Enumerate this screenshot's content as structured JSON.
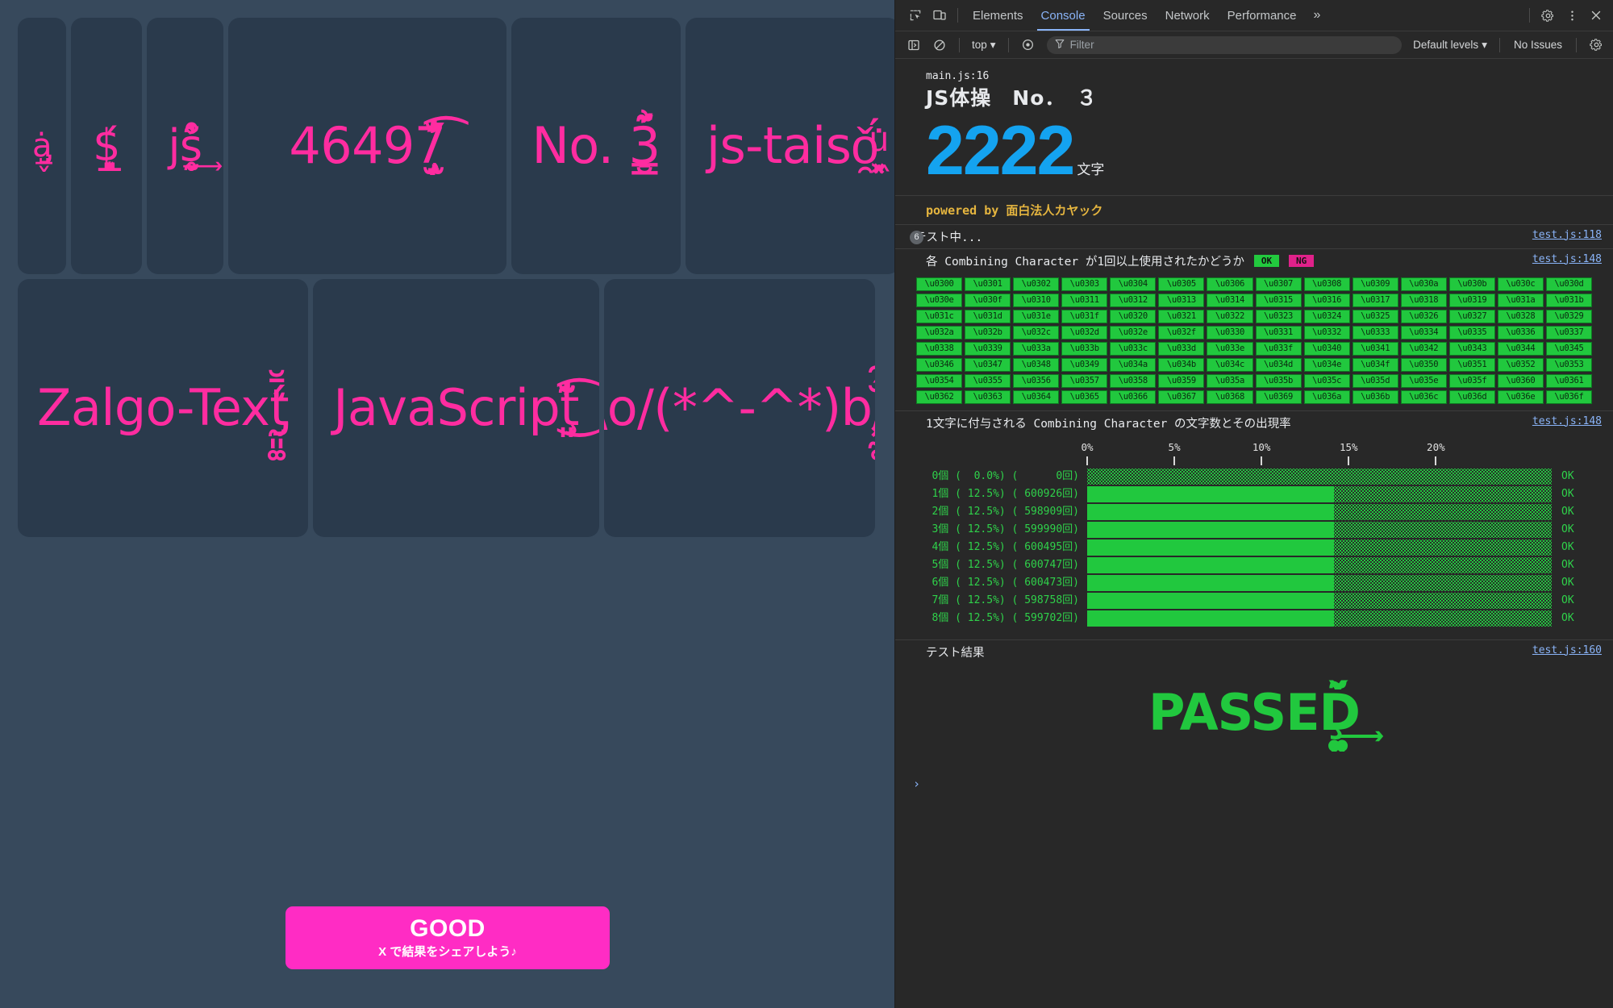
{
  "app": {
    "background": "#37495c",
    "card_background": "#2a3a4c",
    "zalgo_color": "#ff2ca0",
    "cards": [
      {
        "id": "card-a",
        "text": "ȧ̡̲̺̬",
        "size": "z-sm"
      },
      {
        "id": "card-dollar",
        "text": "$̲̟͓͈́",
        "size": "z-md"
      },
      {
        "id": "card-js",
        "text": "js̰̥̓̊̃͢",
        "size": "z-md"
      },
      {
        "id": "card-46497",
        "text": "46497̧̦̟̫̆̋̓́͡",
        "size": "z-lg"
      },
      {
        "id": "card-no3",
        "text": "No. 3̮̳͇́̄̃͂͗",
        "size": "z-lg"
      },
      {
        "id": "card-js-taiso",
        "text": "js-taisǒ̯͖͙͓́̇ͧ",
        "size": "z-lg"
      },
      {
        "id": "card-zalgo-text",
        "text": "Zalgo-Text̡̰͈͚́̄̆̒",
        "size": "z-lg"
      },
      {
        "id": "card-javascript",
        "text": "JavaScripţ͈̆̓̃͜͡",
        "size": "z-lg"
      },
      {
        "id": "card-kaomoji",
        "text": "\\o/(*^-^*)b/͓̰̥̆́̑",
        "size": "z-lg"
      }
    ],
    "share_button": {
      "title": "GOOD",
      "subtitle": "X で結果をシェアしよう♪",
      "color": "#ff2cc4"
    }
  },
  "devtools": {
    "tabs": [
      {
        "label": "Elements",
        "active": false
      },
      {
        "label": "Console",
        "active": true
      },
      {
        "label": "Sources",
        "active": false
      },
      {
        "label": "Network",
        "active": false
      },
      {
        "label": "Performance",
        "active": false
      }
    ],
    "more_tabs_glyph": "»",
    "toolbar": {
      "context": "top",
      "filter_placeholder": "Filter",
      "filter_value": "",
      "levels": "Default levels",
      "issues": "No Issues"
    },
    "accent_link": "#8ab4f8",
    "prompt_glyph": "›"
  },
  "console": {
    "banner": {
      "title": "JS体操　No．　３",
      "count": "2222",
      "unit": "文字",
      "source": "main.js:16"
    },
    "powered": "powered by 面白法人カヤック",
    "testing": {
      "badge": "6",
      "text": "テスト中...",
      "source": "test.js:118"
    },
    "cc_test": {
      "text": "各 Combining Character が1回以上使用されたかどうか",
      "legend_ok": "OK",
      "legend_ng": "NG",
      "source": "test.js:148",
      "codepoints": [
        "\\u0300",
        "\\u0301",
        "\\u0302",
        "\\u0303",
        "\\u0304",
        "\\u0305",
        "\\u0306",
        "\\u0307",
        "\\u0308",
        "\\u0309",
        "\\u030a",
        "\\u030b",
        "\\u030c",
        "\\u030d",
        "\\u030e",
        "\\u030f",
        "\\u0310",
        "\\u0311",
        "\\u0312",
        "\\u0313",
        "\\u0314",
        "\\u0315",
        "\\u0316",
        "\\u0317",
        "\\u0318",
        "\\u0319",
        "\\u031a",
        "\\u031b",
        "\\u031c",
        "\\u031d",
        "\\u031e",
        "\\u031f",
        "\\u0320",
        "\\u0321",
        "\\u0322",
        "\\u0323",
        "\\u0324",
        "\\u0325",
        "\\u0326",
        "\\u0327",
        "\\u0328",
        "\\u0329",
        "\\u032a",
        "\\u032b",
        "\\u032c",
        "\\u032d",
        "\\u032e",
        "\\u032f",
        "\\u0330",
        "\\u0331",
        "\\u0332",
        "\\u0333",
        "\\u0334",
        "\\u0335",
        "\\u0336",
        "\\u0337",
        "\\u0338",
        "\\u0339",
        "\\u033a",
        "\\u033b",
        "\\u033c",
        "\\u033d",
        "\\u033e",
        "\\u033f",
        "\\u0340",
        "\\u0341",
        "\\u0342",
        "\\u0343",
        "\\u0344",
        "\\u0345",
        "\\u0346",
        "\\u0347",
        "\\u0348",
        "\\u0349",
        "\\u034a",
        "\\u034b",
        "\\u034c",
        "\\u034d",
        "\\u034e",
        "\\u034f",
        "\\u0350",
        "\\u0351",
        "\\u0352",
        "\\u0353",
        "\\u0354",
        "\\u0355",
        "\\u0356",
        "\\u0357",
        "\\u0358",
        "\\u0359",
        "\\u035a",
        "\\u035b",
        "\\u035c",
        "\\u035d",
        "\\u035e",
        "\\u035f",
        "\\u0360",
        "\\u0361",
        "\\u0362",
        "\\u0363",
        "\\u0364",
        "\\u0365",
        "\\u0366",
        "\\u0367",
        "\\u0368",
        "\\u0369",
        "\\u036a",
        "\\u036b",
        "\\u036c",
        "\\u036d",
        "\\u036e",
        "\\u036f"
      ]
    },
    "histogram": {
      "text": "1文字に付与される Combining Character の文字数とその出現率",
      "source": "test.js:148"
    },
    "result": {
      "text": "テスト結果",
      "source": "test.js:160",
      "passed_text": "PASSEḐ͈͓͚̆́̌̃͢"
    }
  },
  "chart_data": {
    "type": "bar",
    "title": "1文字に付与される Combining Character の文字数とその出現率",
    "xlabel": "",
    "ylabel": "",
    "orientation": "horizontal",
    "xlim": [
      0,
      23.5
    ],
    "grid": false,
    "tick_labels": [
      "0%",
      "5%",
      "10%",
      "15%",
      "20%"
    ],
    "tick_values": [
      0,
      5,
      10,
      15,
      20
    ],
    "bar_color": "#21c83e",
    "track_color": "#2a2a2a",
    "categories": [
      "0個",
      "1個",
      "2個",
      "3個",
      "4個",
      "5個",
      "6個",
      "7個",
      "8個"
    ],
    "values": [
      0.0,
      12.5,
      12.5,
      12.5,
      12.5,
      12.5,
      12.5,
      12.5,
      12.5
    ],
    "counts": [
      0,
      600926,
      598909,
      599990,
      600495,
      600747,
      600473,
      598758,
      599702
    ],
    "statuses": [
      "OK",
      "OK",
      "OK",
      "OK",
      "OK",
      "OK",
      "OK",
      "OK",
      "OK"
    ],
    "rows": [
      {
        "label": "0個 (  0.0%) (      0回)",
        "percent": 0.0,
        "status": "OK"
      },
      {
        "label": "1個 ( 12.5%) ( 600926回)",
        "percent": 12.5,
        "status": "OK"
      },
      {
        "label": "2個 ( 12.5%) ( 598909回)",
        "percent": 12.5,
        "status": "OK"
      },
      {
        "label": "3個 ( 12.5%) ( 599990回)",
        "percent": 12.5,
        "status": "OK"
      },
      {
        "label": "4個 ( 12.5%) ( 600495回)",
        "percent": 12.5,
        "status": "OK"
      },
      {
        "label": "5個 ( 12.5%) ( 600747回)",
        "percent": 12.5,
        "status": "OK"
      },
      {
        "label": "6個 ( 12.5%) ( 600473回)",
        "percent": 12.5,
        "status": "OK"
      },
      {
        "label": "7個 ( 12.5%) ( 598758回)",
        "percent": 12.5,
        "status": "OK"
      },
      {
        "label": "8個 ( 12.5%) ( 599702回)",
        "percent": 12.5,
        "status": "OK"
      }
    ]
  }
}
